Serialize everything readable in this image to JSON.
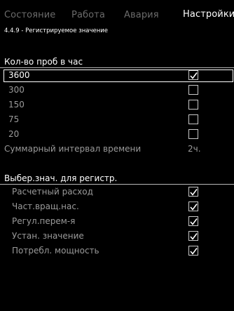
{
  "tabs": [
    {
      "label": "Состояние",
      "active": false
    },
    {
      "label": "Работа",
      "active": false
    },
    {
      "label": "Авария",
      "active": false
    },
    {
      "label": "Настройки",
      "active": true
    }
  ],
  "breadcrumb": "4.4.9 - Регистрируемое значение",
  "samples": {
    "title": "Кол-во проб в час",
    "options": [
      {
        "label": "3600",
        "checked": true,
        "selected": true
      },
      {
        "label": "300",
        "checked": false,
        "selected": false
      },
      {
        "label": "150",
        "checked": false,
        "selected": false
      },
      {
        "label": "75",
        "checked": false,
        "selected": false
      },
      {
        "label": "20",
        "checked": false,
        "selected": false
      }
    ],
    "summary_label": "Суммарный интервал времени",
    "summary_value": "2ч."
  },
  "values": {
    "title": "Выбер.знач. для регистр.",
    "items": [
      {
        "label": "Расчетный расход",
        "checked": true
      },
      {
        "label": "Част.вращ.нас.",
        "checked": true
      },
      {
        "label": "Регул.перем-я",
        "checked": true
      },
      {
        "label": "Устан. значение",
        "checked": true
      },
      {
        "label": "Потребл. мощность",
        "checked": true
      }
    ]
  },
  "colors": {
    "background": "#000000",
    "active_text": "#ffffff",
    "inactive_text": "#9a9a9a",
    "tab_inactive": "#6b6b6b"
  }
}
